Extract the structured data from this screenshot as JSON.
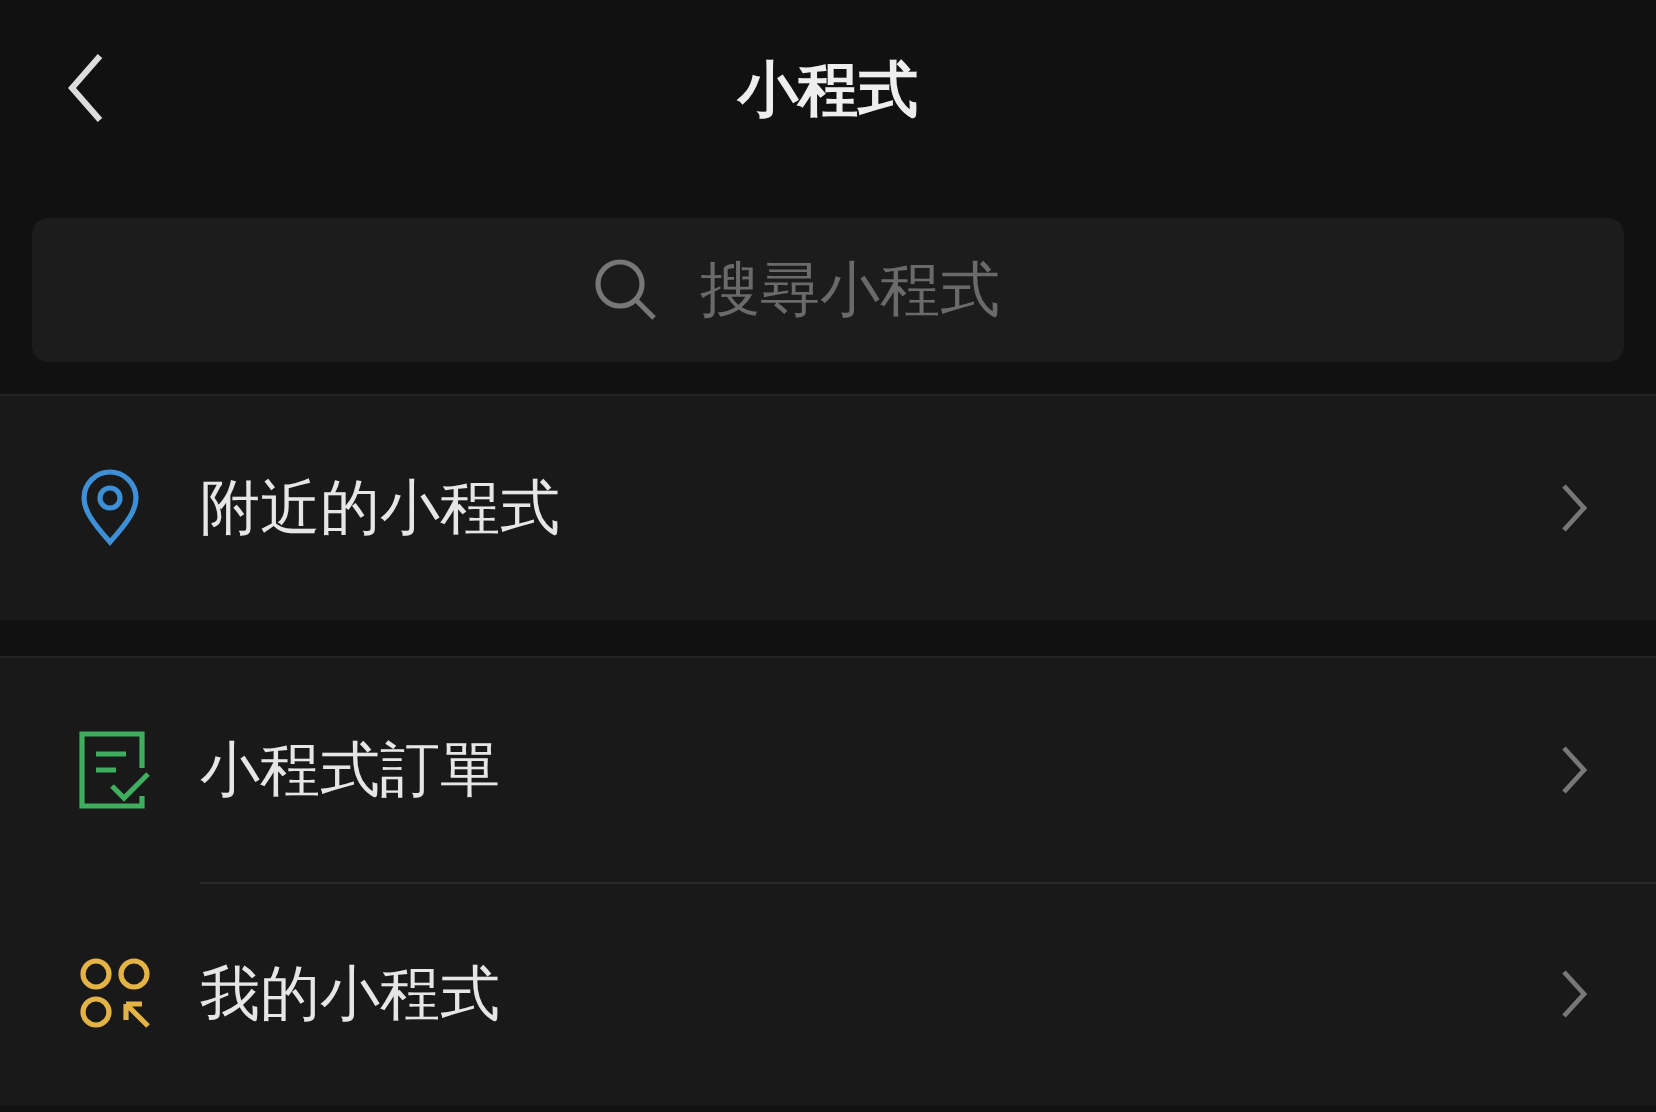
{
  "header": {
    "title": "小程式"
  },
  "search": {
    "placeholder": "搜尋小程式"
  },
  "sections": [
    {
      "items": [
        {
          "kind": "nearby",
          "label": "附近的小程式"
        }
      ]
    },
    {
      "items": [
        {
          "kind": "orders",
          "label": "小程式訂單"
        },
        {
          "kind": "mine",
          "label": "我的小程式"
        }
      ]
    }
  ]
}
